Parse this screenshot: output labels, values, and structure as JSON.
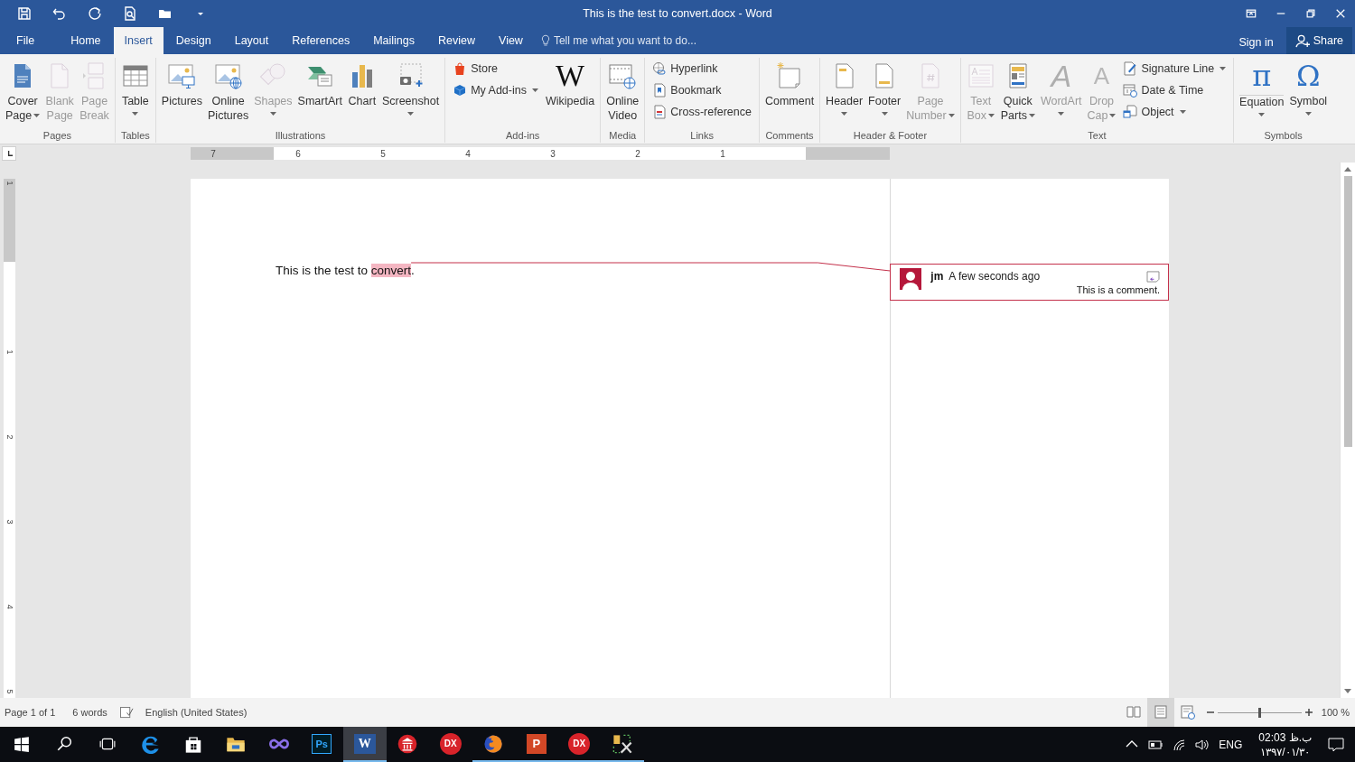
{
  "title_bar": {
    "title": "This is the test to convert.docx - Word"
  },
  "tabs": [
    {
      "label": "File",
      "selected": false
    },
    {
      "label": "Home",
      "selected": false
    },
    {
      "label": "Insert",
      "selected": true
    },
    {
      "label": "Design",
      "selected": false
    },
    {
      "label": "Layout",
      "selected": false
    },
    {
      "label": "References",
      "selected": false
    },
    {
      "label": "Mailings",
      "selected": false
    },
    {
      "label": "Review",
      "selected": false
    },
    {
      "label": "View",
      "selected": false
    }
  ],
  "tell_me": {
    "placeholder": "Tell me what you want to do..."
  },
  "account": {
    "sign_in": "Sign in",
    "share": "Share"
  },
  "ribbon": {
    "groups": [
      {
        "label": "Pages",
        "items": [
          {
            "kind": "large",
            "lines": [
              "Cover",
              "Page"
            ],
            "dropdown": true,
            "disabled": false
          },
          {
            "kind": "large",
            "lines": [
              "Blank",
              "Page"
            ],
            "dropdown": false,
            "disabled": true
          },
          {
            "kind": "large",
            "lines": [
              "Page",
              "Break"
            ],
            "dropdown": false,
            "disabled": true
          }
        ]
      },
      {
        "label": "Tables",
        "items": [
          {
            "kind": "large",
            "lines": [
              "Table"
            ],
            "dropdown": true,
            "disabled": false
          }
        ]
      },
      {
        "label": "Illustrations",
        "items": [
          {
            "kind": "large",
            "lines": [
              "Pictures"
            ],
            "dropdown": false,
            "disabled": false
          },
          {
            "kind": "large",
            "lines": [
              "Online",
              "Pictures"
            ],
            "dropdown": false,
            "disabled": false
          },
          {
            "kind": "large",
            "lines": [
              "Shapes"
            ],
            "dropdown": true,
            "disabled": true
          },
          {
            "kind": "large",
            "lines": [
              "SmartArt"
            ],
            "dropdown": false,
            "disabled": false
          },
          {
            "kind": "large",
            "lines": [
              "Chart"
            ],
            "dropdown": false,
            "disabled": false
          },
          {
            "kind": "large",
            "lines": [
              "Screenshot"
            ],
            "dropdown": true,
            "disabled": false
          }
        ]
      },
      {
        "label": "Add-ins",
        "items": [
          {
            "kind": "small",
            "lines": [
              "Store"
            ],
            "dropdown": false,
            "disabled": false
          },
          {
            "kind": "small",
            "lines": [
              "My Add-ins"
            ],
            "dropdown": true,
            "disabled": false
          },
          {
            "kind": "large",
            "lines": [
              "Wikipedia"
            ],
            "glyph": "W",
            "dropdown": false,
            "disabled": false
          }
        ]
      },
      {
        "label": "Media",
        "items": [
          {
            "kind": "large",
            "lines": [
              "Online",
              "Video"
            ],
            "dropdown": false,
            "disabled": false
          }
        ]
      },
      {
        "label": "Links",
        "items": [
          {
            "kind": "small",
            "lines": [
              "Hyperlink"
            ],
            "dropdown": false,
            "disabled": false
          },
          {
            "kind": "small",
            "lines": [
              "Bookmark"
            ],
            "dropdown": false,
            "disabled": false
          },
          {
            "kind": "small",
            "lines": [
              "Cross-reference"
            ],
            "dropdown": false,
            "disabled": false
          }
        ]
      },
      {
        "label": "Comments",
        "items": [
          {
            "kind": "large",
            "lines": [
              "Comment"
            ],
            "dropdown": false,
            "disabled": false
          }
        ]
      },
      {
        "label": "Header & Footer",
        "items": [
          {
            "kind": "large",
            "lines": [
              "Header"
            ],
            "dropdown": true,
            "disabled": false
          },
          {
            "kind": "large",
            "lines": [
              "Footer"
            ],
            "dropdown": true,
            "disabled": false
          },
          {
            "kind": "large",
            "lines": [
              "Page",
              "Number"
            ],
            "dropdown": true,
            "disabled": true
          }
        ]
      },
      {
        "label": "Text",
        "items": [
          {
            "kind": "large",
            "lines": [
              "Text",
              "Box"
            ],
            "dropdown": true,
            "disabled": true
          },
          {
            "kind": "large",
            "lines": [
              "Quick",
              "Parts"
            ],
            "dropdown": true,
            "disabled": false
          },
          {
            "kind": "large",
            "lines": [
              "WordArt"
            ],
            "glyph": "A",
            "dropdown": true,
            "disabled": true
          },
          {
            "kind": "large",
            "lines": [
              "Drop",
              "Cap"
            ],
            "glyph": "A",
            "dropdown": true,
            "disabled": true
          },
          {
            "kind": "small",
            "lines": [
              "Signature Line"
            ],
            "dropdown": true,
            "disabled": false
          },
          {
            "kind": "small",
            "lines": [
              "Date & Time"
            ],
            "dropdown": false,
            "disabled": false
          },
          {
            "kind": "small",
            "lines": [
              "Object"
            ],
            "dropdown": true,
            "disabled": false
          }
        ]
      },
      {
        "label": "Symbols",
        "items": [
          {
            "kind": "large",
            "lines": [
              "Equation"
            ],
            "glyph": "π",
            "dropdown": true,
            "disabled": false
          },
          {
            "kind": "large",
            "lines": [
              "Symbol"
            ],
            "glyph": "Ω",
            "dropdown": true,
            "disabled": false
          }
        ]
      }
    ]
  },
  "ruler": {
    "labels": [
      "7",
      "6",
      "5",
      "4",
      "3",
      "2",
      "1"
    ]
  },
  "vertical_ruler": {
    "labels": [
      "1",
      "1",
      "2",
      "3",
      "4",
      "5"
    ]
  },
  "document": {
    "paragraph": {
      "before": "This is the test to ",
      "commented": "convert",
      "after": "."
    }
  },
  "comment": {
    "author": "jm",
    "time": "A few seconds ago",
    "text": "This is a comment."
  },
  "status_bar": {
    "page": "Page 1 of 1",
    "words": "6 words",
    "language": "English (United States)",
    "views": [
      {
        "selected": false
      },
      {
        "selected": true
      },
      {
        "selected": false
      }
    ],
    "zoom": {
      "level": 0.5,
      "reading": "100 %"
    }
  },
  "taskbar": {
    "apps": [
      {
        "running": false,
        "selected": false
      },
      {
        "running": false,
        "selected": false
      },
      {
        "running": false,
        "selected": false
      },
      {
        "running": false,
        "selected": false
      },
      {
        "glyph": "Ps",
        "running": false,
        "selected": false
      },
      {
        "glyph": "W",
        "running": true,
        "selected": true
      },
      {
        "running": false,
        "selected": false
      },
      {
        "glyph": "DX",
        "running": false,
        "selected": false
      },
      {
        "running": true,
        "selected": false
      },
      {
        "glyph": "P",
        "running": true,
        "selected": false
      },
      {
        "glyph": "DX",
        "running": true,
        "selected": false
      },
      {
        "running": true,
        "selected": false
      }
    ],
    "tray": {
      "language": "ENG",
      "time": "02:03 ب.ظ",
      "date": "۱۳۹۷/۰۱/۳۰"
    }
  }
}
